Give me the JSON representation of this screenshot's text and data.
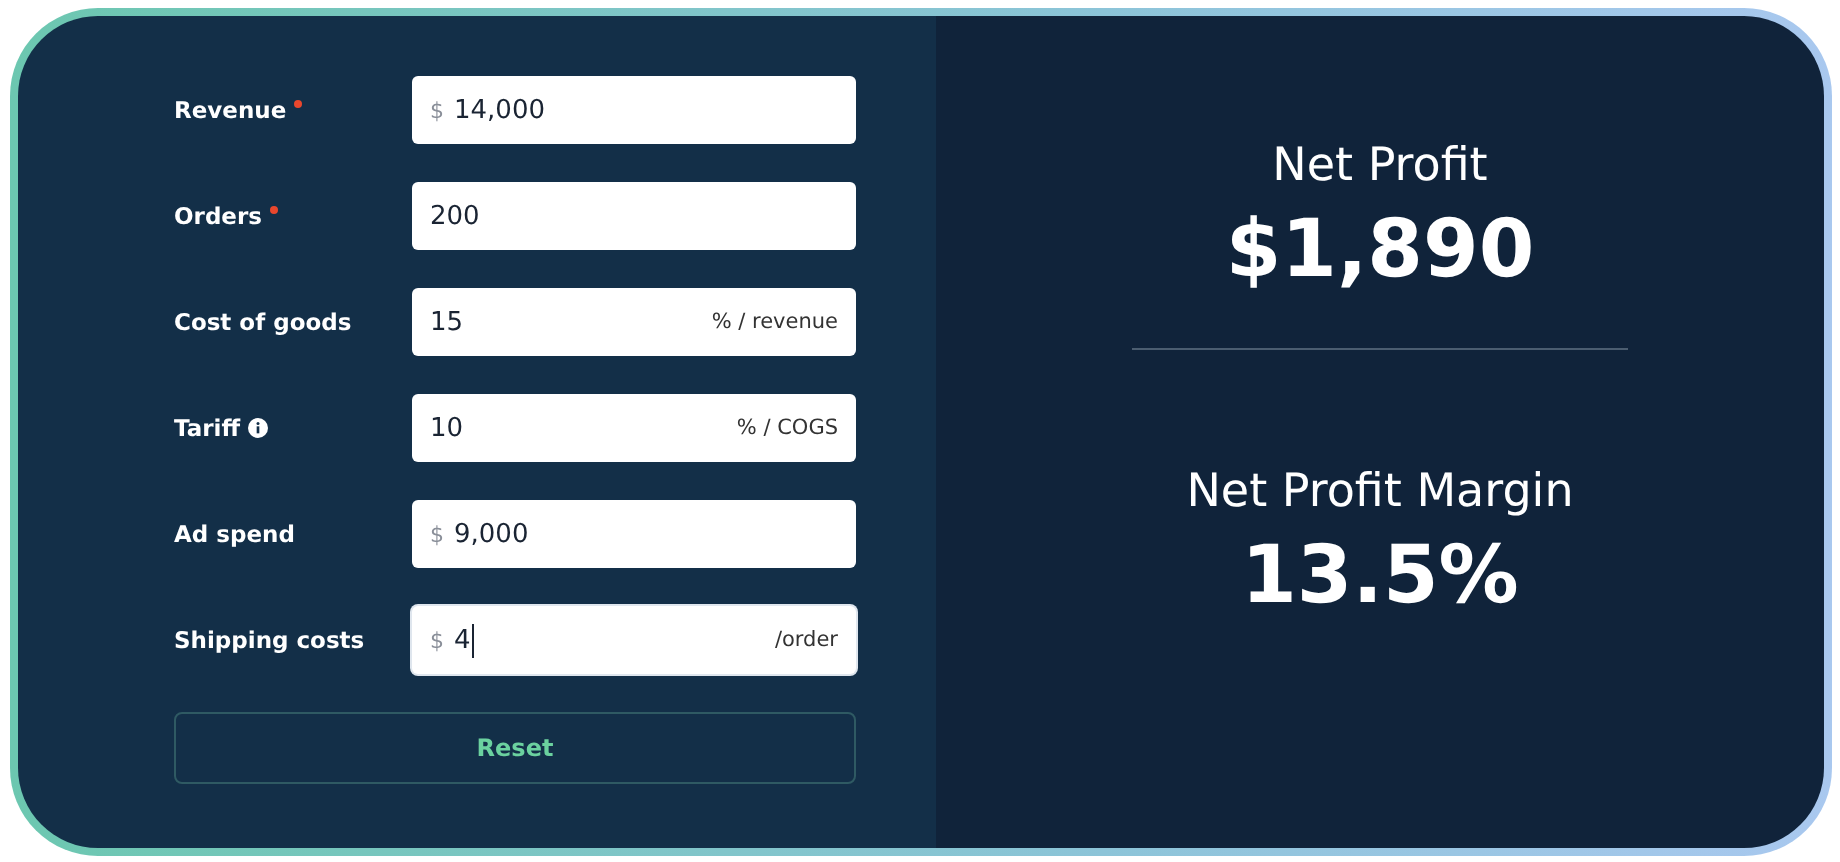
{
  "fields": [
    {
      "label": "Revenue",
      "required": true,
      "info": false,
      "prefix": "$",
      "value": "14,000",
      "focused": false
    },
    {
      "label": "Orders",
      "required": true,
      "info": false,
      "value": "200",
      "focused": false
    },
    {
      "label": "Cost of goods",
      "required": false,
      "info": false,
      "value": "15",
      "suffix": "% / revenue",
      "focused": false
    },
    {
      "label": "Tariff",
      "required": false,
      "info": true,
      "value": "10",
      "suffix": "% / COGS",
      "focused": false
    },
    {
      "label": "Ad spend",
      "required": false,
      "info": false,
      "prefix": "$",
      "value": "9,000",
      "focused": false
    },
    {
      "label": "Shipping costs",
      "required": false,
      "info": false,
      "prefix": "$",
      "value": "4",
      "suffix": "/order",
      "focused": true
    }
  ],
  "reset_button": "Reset",
  "results": [
    {
      "label": "Net Profit",
      "value": "$1,890"
    },
    {
      "label": "Net Profit Margin",
      "value": "13.5%"
    }
  ]
}
